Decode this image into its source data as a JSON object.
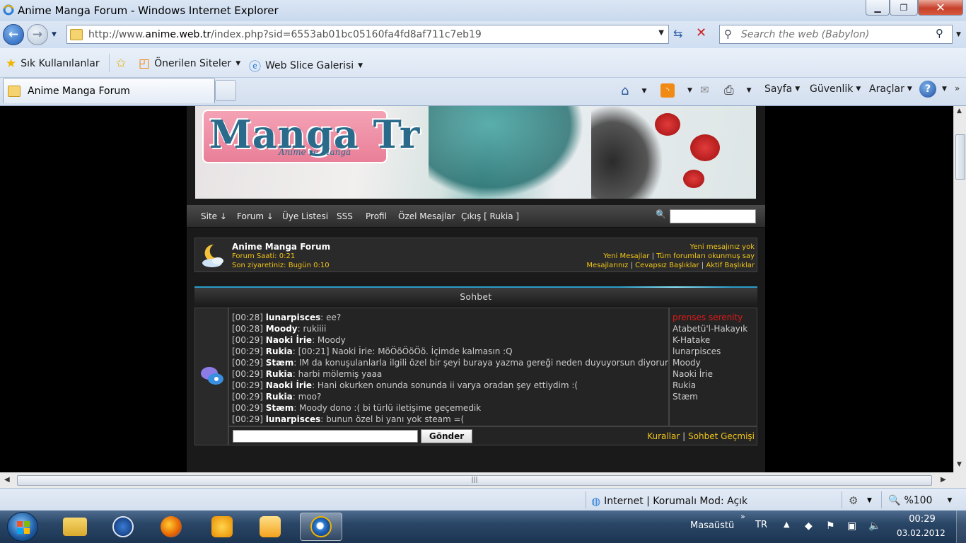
{
  "window": {
    "title": "Anime Manga Forum - Windows Internet Explorer",
    "minimize_icon": "minimize-icon",
    "maximize_icon": "maximize-icon",
    "close_icon": "close-icon"
  },
  "address_bar": {
    "url_prefix": "http://www.",
    "url_domain": "anime.web.tr",
    "url_suffix": "/index.php?sid=6553ab01bc05160fa4fd8af711c7eb19"
  },
  "search": {
    "placeholder": "Search the web (Babylon)"
  },
  "favorites_bar": {
    "favorites": "Sık Kullanılanlar",
    "suggested": "Önerilen Siteler",
    "web_slice": "Web Slice Galerisi"
  },
  "tab": {
    "label": "Anime Manga Forum"
  },
  "command_bar": {
    "page": "Sayfa",
    "security": "Güvenlik",
    "tools": "Araçlar"
  },
  "forum": {
    "menu": {
      "site": "Site",
      "forum": "Forum",
      "members": "Üye Listesi",
      "faq": "SSS",
      "profile": "Profil",
      "messages": "Özel Mesajlar",
      "logout": "Çıkış [ Rukia ]"
    },
    "info": {
      "title": "Anime Manga Forum",
      "time": "Forum Saati: 0:21",
      "last_visit": "Son ziyaretiniz: Bugün 0:10",
      "no_new_pm": "Yeni mesajınız yok",
      "new_posts": "Yeni Mesajlar",
      "mark_read": "Tüm forumları okunmuş say",
      "your_posts": "Mesajlarınız",
      "unanswered": "Cevapsız Başlıklar",
      "active": "Aktif Başlıklar"
    },
    "chat": {
      "header": "Sohbet",
      "messages": [
        {
          "time": "[00:28]",
          "nick": "lunarpisces",
          "text": ": ee?"
        },
        {
          "time": "[00:28]",
          "nick": "Moody",
          "text": ": rukiiii"
        },
        {
          "time": "[00:29]",
          "nick": "Naoki İrie",
          "text": ": Moody"
        },
        {
          "time": "[00:29]",
          "nick": "Rukia",
          "text": ": [00:21] Naoki İrie: MöÖöÖöÖö. İçimde kalmasın :Q"
        },
        {
          "time": "[00:29]",
          "nick": "Stæm",
          "text": ": IM da konuşulanlarla ilgili özel bir şeyi buraya yazma gereği neden duyuyorsun diyorum?"
        },
        {
          "time": "[00:29]",
          "nick": "Rukia",
          "text": ": harbi mölemiş yaaa"
        },
        {
          "time": "[00:29]",
          "nick": "Naoki İrie",
          "text": ": Hani okurken onunda sonunda ii varya oradan şey ettiydim :("
        },
        {
          "time": "[00:29]",
          "nick": "Rukia",
          "text": ": moo?"
        },
        {
          "time": "[00:29]",
          "nick": "Stæm",
          "text": ": Moody dono :( bi türlü iletişime geçemedik"
        },
        {
          "time": "[00:29]",
          "nick": "lunarpisces",
          "text": ": bunun özel bi yanı yok steam =("
        }
      ],
      "users": [
        {
          "name": "prenses serenity",
          "highlight": true
        },
        {
          "name": "Atabetü'l-Hakayık",
          "highlight": false
        },
        {
          "name": "K-Hatake",
          "highlight": false
        },
        {
          "name": "lunarpisces",
          "highlight": false
        },
        {
          "name": "Moody",
          "highlight": false
        },
        {
          "name": "Naoki İrie",
          "highlight": false
        },
        {
          "name": "Rukia",
          "highlight": false
        },
        {
          "name": "Stæm",
          "highlight": false
        }
      ],
      "send_label": "Gönder",
      "rules": "Kurallar",
      "history": "Sohbet Geçmişi"
    }
  },
  "status_bar": {
    "zone": "Internet | Korumalı Mod: Açık",
    "zoom": "%100"
  },
  "taskbar": {
    "desktop": "Masaüstü",
    "lang": "TR",
    "time": "00:29",
    "date": "03.02.2012"
  },
  "colors": {
    "link_yellow": "#f0c419",
    "online_red": "#e01919",
    "accent_blue": "#2a9cc9"
  }
}
